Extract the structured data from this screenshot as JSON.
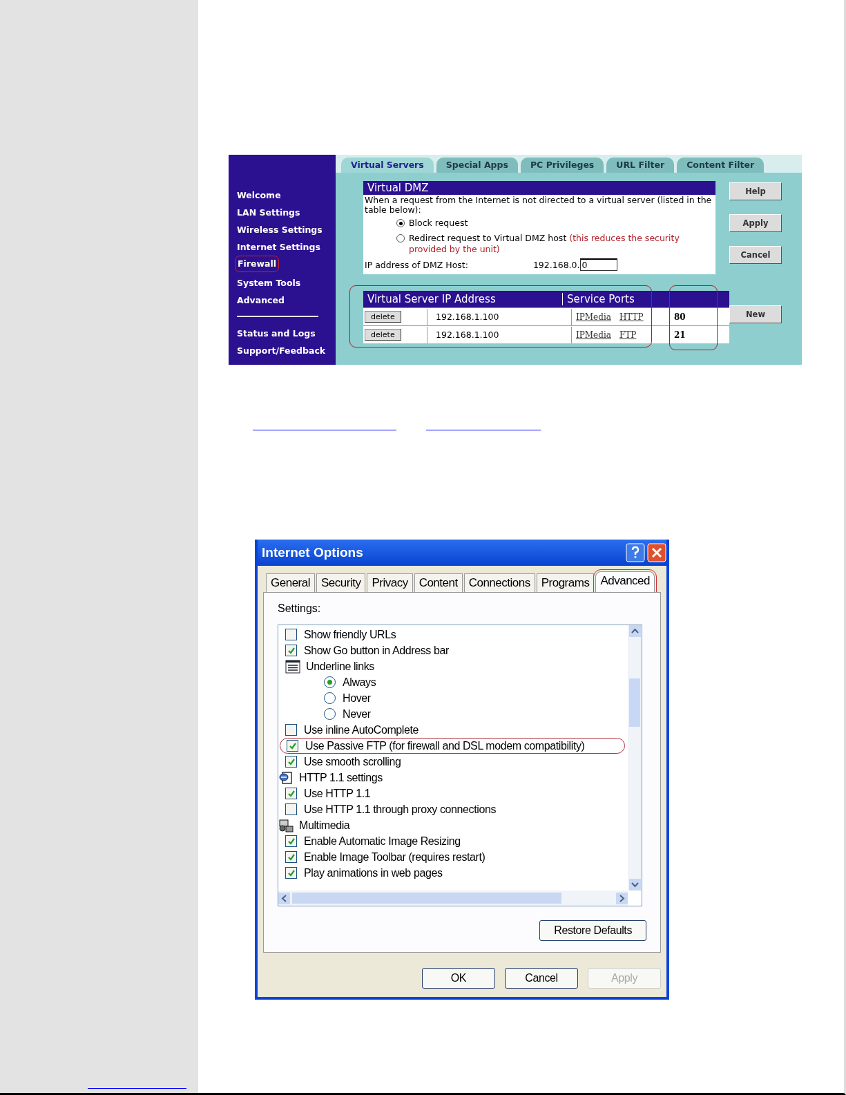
{
  "router_screen": {
    "nav": [
      {
        "label": "Welcome",
        "selected": false,
        "highlighted": false
      },
      {
        "label": "LAN Settings",
        "selected": false,
        "highlighted": false
      },
      {
        "label": "Wireless Settings",
        "selected": false,
        "highlighted": false
      },
      {
        "label": "Internet Settings",
        "selected": false,
        "highlighted": false
      },
      {
        "label": "Firewall",
        "selected": true,
        "highlighted": true
      },
      {
        "label": "System Tools",
        "selected": false,
        "highlighted": false
      },
      {
        "label": "Advanced",
        "selected": false,
        "highlighted": false
      }
    ],
    "nav_bottom": [
      {
        "label": "Status and Logs",
        "selected": false,
        "highlighted": false
      },
      {
        "label": "Support/Feedback",
        "selected": false,
        "highlighted": false
      }
    ],
    "tabs": [
      {
        "label": "Virtual Servers",
        "selected": true
      },
      {
        "label": "Special Apps",
        "selected": false
      },
      {
        "label": "PC Privileges",
        "selected": false
      },
      {
        "label": "URL Filter",
        "selected": false
      },
      {
        "label": "Content Filter",
        "selected": false
      }
    ],
    "dmz": {
      "title": "Virtual DMZ",
      "description": "When a request from the Internet is not directed to a virtual server (listed in the table below):",
      "options": [
        {
          "label": "Block request",
          "selected": true
        },
        {
          "label": "Redirect request to Virtual DMZ host",
          "note": "(this reduces the security provided by the unit)",
          "selected": false
        }
      ],
      "ip_label": "IP address of DMZ Host:",
      "ip_prefix": "192.168.0.",
      "ip_value": "0"
    },
    "side_buttons": [
      "Help",
      "Apply",
      "Cancel"
    ],
    "new_button": "New",
    "table": {
      "columns": [
        "Virtual Server IP Address",
        "Service Ports"
      ],
      "highlighted": true,
      "rows": [
        {
          "action": "delete",
          "ip": "192.168.1.100",
          "service": "IPMedia",
          "protocol": "HTTP",
          "port": "80"
        },
        {
          "action": "delete",
          "ip": "192.168.1.100",
          "service": "IPMedia",
          "protocol": "FTP",
          "port": "21"
        }
      ]
    }
  },
  "dialog": {
    "title": "Internet Options",
    "tabs": [
      {
        "label": "General",
        "selected": false,
        "highlighted": false
      },
      {
        "label": "Security",
        "selected": false,
        "highlighted": false
      },
      {
        "label": "Privacy",
        "selected": false,
        "highlighted": false
      },
      {
        "label": "Content",
        "selected": false,
        "highlighted": false
      },
      {
        "label": "Connections",
        "selected": false,
        "highlighted": false
      },
      {
        "label": "Programs",
        "selected": false,
        "highlighted": false
      },
      {
        "label": "Advanced",
        "selected": true,
        "highlighted": true
      }
    ],
    "settings_label": "Settings:",
    "settings": [
      {
        "kind": "group",
        "children": [
          {
            "kind": "checkbox",
            "label": "Show friendly URLs",
            "checked": false,
            "highlighted": false
          },
          {
            "kind": "checkbox",
            "label": "Show Go button in Address bar",
            "checked": true,
            "highlighted": false
          },
          {
            "kind": "group",
            "label": "Underline links",
            "children": [
              {
                "kind": "radio",
                "label": "Always",
                "selected": true
              },
              {
                "kind": "radio",
                "label": "Hover",
                "selected": false
              },
              {
                "kind": "radio",
                "label": "Never",
                "selected": false
              }
            ]
          },
          {
            "kind": "checkbox",
            "label": "Use inline AutoComplete",
            "checked": false,
            "highlighted": false
          },
          {
            "kind": "checkbox",
            "label": "Use Passive FTP (for firewall and DSL modem compatibility)",
            "checked": true,
            "highlighted": true
          },
          {
            "kind": "checkbox",
            "label": "Use smooth scrolling",
            "checked": true,
            "highlighted": false
          }
        ]
      },
      {
        "kind": "group",
        "label": "HTTP 1.1 settings",
        "children": [
          {
            "kind": "checkbox",
            "label": "Use HTTP 1.1",
            "checked": true,
            "highlighted": false
          },
          {
            "kind": "checkbox",
            "label": "Use HTTP 1.1 through proxy connections",
            "checked": false,
            "highlighted": false
          }
        ]
      },
      {
        "kind": "group",
        "label": "Multimedia",
        "children": [
          {
            "kind": "checkbox",
            "label": "Enable Automatic Image Resizing",
            "checked": true,
            "highlighted": false
          },
          {
            "kind": "checkbox",
            "label": "Enable Image Toolbar (requires restart)",
            "checked": true,
            "highlighted": false
          },
          {
            "kind": "checkbox",
            "label": "Play animations in web pages",
            "checked": true,
            "highlighted": false
          }
        ]
      }
    ],
    "restore_button": "Restore Defaults",
    "buttons": [
      {
        "label": "OK",
        "disabled": false
      },
      {
        "label": "Cancel",
        "disabled": false
      },
      {
        "label": "Apply",
        "disabled": true
      }
    ]
  }
}
